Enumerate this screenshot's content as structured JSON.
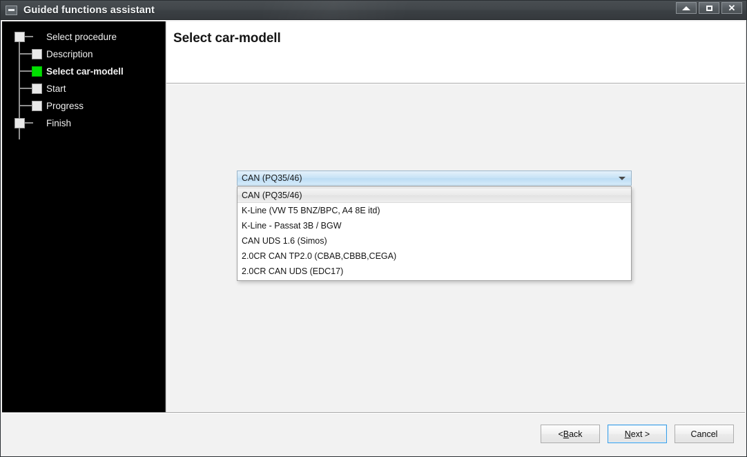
{
  "window": {
    "title": "Guided functions assistant",
    "icon": "window-menu-icon",
    "controls": {
      "minimize": "minimize-icon",
      "restore": "restore-icon",
      "close": "close-icon"
    }
  },
  "sidebar": {
    "steps": [
      {
        "label": "Select procedure",
        "level": "root",
        "state": "pending"
      },
      {
        "label": "Description",
        "level": "child",
        "state": "pending"
      },
      {
        "label": "Select car-modell",
        "level": "child",
        "state": "current"
      },
      {
        "label": "Start",
        "level": "child",
        "state": "pending"
      },
      {
        "label": "Progress",
        "level": "child",
        "state": "pending"
      },
      {
        "label": "Finish",
        "level": "root",
        "state": "pending"
      }
    ],
    "current_color": "#00e000",
    "node_color": "#e9e9e9",
    "background": "#000000"
  },
  "content": {
    "page_title": "Select car-modell"
  },
  "combobox": {
    "name": "car-model-select",
    "selected": "CAN (PQ35/46)",
    "expanded": true,
    "arrow_icon": "chevron-down-icon",
    "options": [
      {
        "label": "CAN (PQ35/46)",
        "highlighted": true
      },
      {
        "label": "K-Line (VW T5 BNZ/BPC, A4 8E itd)",
        "highlighted": false
      },
      {
        "label": "K-Line - Passat 3B / BGW",
        "highlighted": false
      },
      {
        "label": "CAN UDS 1.6 (Simos)",
        "highlighted": false
      },
      {
        "label": "2.0CR CAN TP2.0 (CBAB,CBBB,CEGA)",
        "highlighted": false
      },
      {
        "label": "2.0CR CAN UDS (EDC17)",
        "highlighted": false
      }
    ]
  },
  "footer": {
    "back": {
      "prefix": "< ",
      "accel": "B",
      "rest": "ack"
    },
    "next": {
      "prefix": "",
      "accel": "N",
      "rest": "ext >"
    },
    "cancel": "Cancel"
  }
}
